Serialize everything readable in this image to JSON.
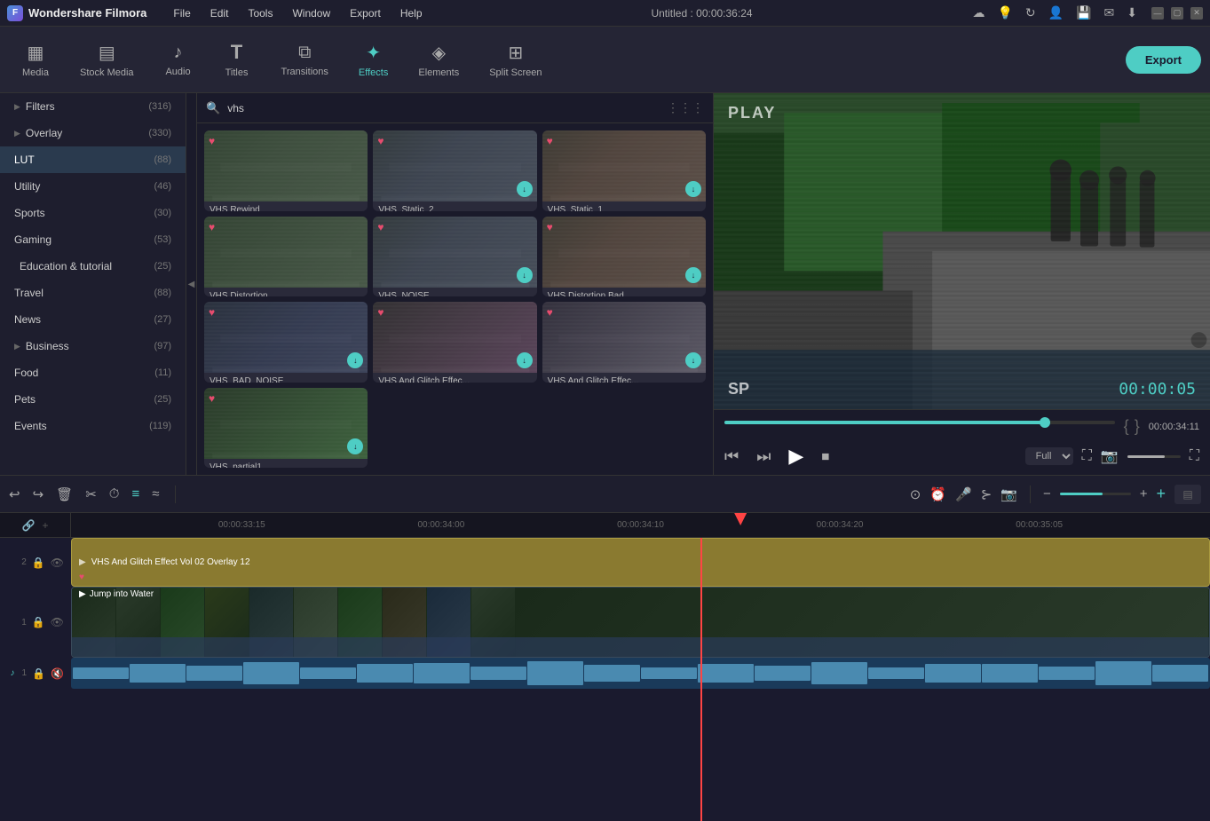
{
  "app": {
    "name": "Wondershare Filmora",
    "title": "Untitled : 00:00:36:24"
  },
  "menu": {
    "items": [
      "File",
      "Edit",
      "Tools",
      "Window",
      "Export",
      "Help"
    ]
  },
  "toolbar": {
    "items": [
      {
        "id": "media",
        "label": "Media",
        "icon": "▦"
      },
      {
        "id": "stock-media",
        "label": "Stock Media",
        "icon": "▤"
      },
      {
        "id": "audio",
        "label": "Audio",
        "icon": "♪"
      },
      {
        "id": "titles",
        "label": "Titles",
        "icon": "T"
      },
      {
        "id": "transitions",
        "label": "Transitions",
        "icon": "⧉"
      },
      {
        "id": "effects",
        "label": "Effects",
        "icon": "✦"
      },
      {
        "id": "elements",
        "label": "Elements",
        "icon": "◈"
      },
      {
        "id": "split-screen",
        "label": "Split Screen",
        "icon": "⊞"
      }
    ],
    "export_label": "Export"
  },
  "sidebar": {
    "items": [
      {
        "label": "Filters",
        "count": "(316)",
        "has_arrow": true
      },
      {
        "label": "Overlay",
        "count": "(330)",
        "has_arrow": true
      },
      {
        "label": "LUT",
        "count": "(88)",
        "active": true
      },
      {
        "label": "Utility",
        "count": "(46)"
      },
      {
        "label": "Sports",
        "count": "(30)"
      },
      {
        "label": "Gaming",
        "count": "(53)"
      },
      {
        "label": "Education & tutorial",
        "count": "(25)"
      },
      {
        "label": "Travel",
        "count": "(88)"
      },
      {
        "label": "News",
        "count": "(27)"
      },
      {
        "label": "Business",
        "count": "(97)",
        "has_arrow": true
      },
      {
        "label": "Food",
        "count": "(11)"
      },
      {
        "label": "Pets",
        "count": "(25)"
      },
      {
        "label": "Events",
        "count": "(119)"
      }
    ]
  },
  "search": {
    "placeholder": "vhs",
    "value": "vhs"
  },
  "effects": {
    "items": [
      {
        "label": "VHS Rewind",
        "type": "vhs1"
      },
      {
        "label": "VHS_Static_2",
        "type": "vhs2"
      },
      {
        "label": "VHS_Static_1",
        "type": "vhs3"
      },
      {
        "label": "VHS Distortion",
        "type": "vhs1"
      },
      {
        "label": "VHS_NOISE",
        "type": "vhs2"
      },
      {
        "label": "VHS Distortion Bad",
        "type": "vhs3"
      },
      {
        "label": "VHS_BAD_NOISE",
        "type": "vhs1"
      },
      {
        "label": "VHS And Glitch Effec...",
        "type": "vhs2"
      },
      {
        "label": "VHS And Glitch Effec...",
        "type": "vhs3"
      },
      {
        "label": "VHS_partial1",
        "type": "vhs1"
      }
    ]
  },
  "preview": {
    "play_label": "PLAY",
    "sp_label": "SP",
    "timecode": "00:00:05",
    "total_time": "00:00:34:11",
    "current_time": "00:00:34:10",
    "quality": "Full",
    "progress_percent": 82
  },
  "timeline": {
    "ruler_marks": [
      "00:00:33:15",
      "00:00:34:00",
      "00:00:34:10",
      "00:00:34:20",
      "00:00:35:05"
    ],
    "tracks": [
      {
        "num": "2",
        "type": "overlay",
        "label": "VHS And Glitch Effect Vol 02 Overlay 12"
      },
      {
        "num": "1",
        "type": "video",
        "label": "Jump into Water"
      }
    ],
    "audio_track": {
      "num": "1",
      "type": "audio"
    }
  }
}
